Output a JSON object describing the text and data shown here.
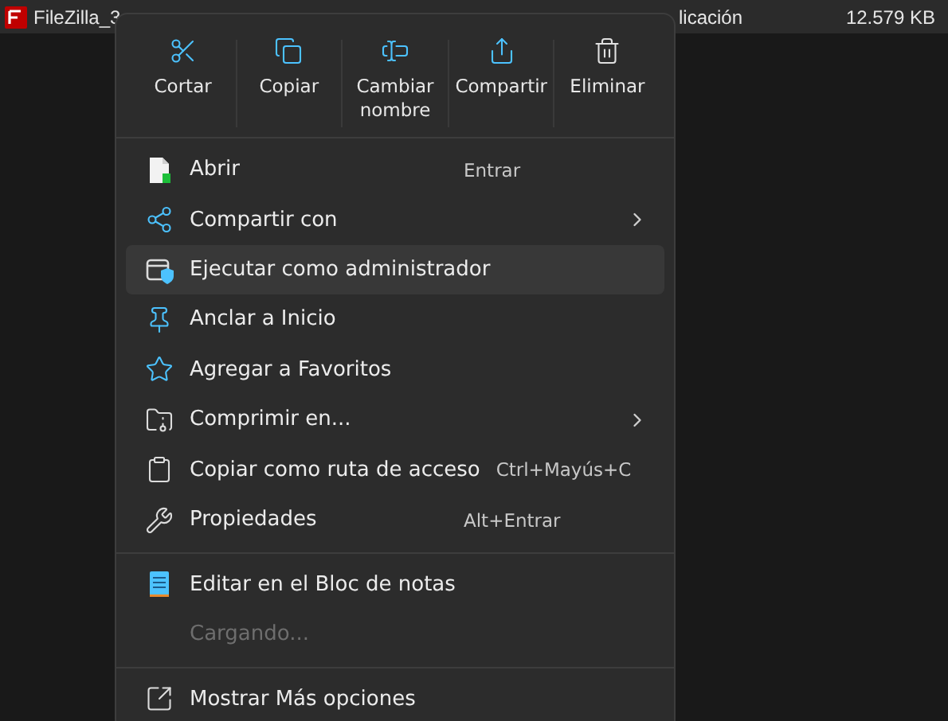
{
  "file_row": {
    "name": "FileZilla_3",
    "type": "licación",
    "size": "12.579 KB"
  },
  "context_menu": {
    "toolbar": [
      {
        "label": "Cortar"
      },
      {
        "label": "Copiar"
      },
      {
        "label": "Cambiar nombre"
      },
      {
        "label": "Compartir"
      },
      {
        "label": "Eliminar"
      }
    ],
    "items": [
      {
        "kind": "item",
        "label": "Abrir",
        "shortcut": "Entrar",
        "submenu": false,
        "selected": false,
        "disabled": false
      },
      {
        "kind": "item",
        "label": "Compartir con",
        "submenu": true,
        "selected": false,
        "disabled": false
      },
      {
        "kind": "item",
        "label": "Ejecutar como administrador",
        "submenu": false,
        "selected": true,
        "disabled": false
      },
      {
        "kind": "item",
        "label": "Anclar a Inicio",
        "submenu": false,
        "selected": false,
        "disabled": false
      },
      {
        "kind": "item",
        "label": "Agregar a Favoritos",
        "submenu": false,
        "selected": false,
        "disabled": false
      },
      {
        "kind": "item",
        "label": "Comprimir en...",
        "submenu": true,
        "selected": false,
        "disabled": false
      },
      {
        "kind": "item",
        "label": "Copiar como ruta de acceso",
        "shortcut": "Ctrl+Mayús+C",
        "submenu": false,
        "selected": false,
        "disabled": false
      },
      {
        "kind": "item",
        "label": "Propiedades",
        "shortcut": "Alt+Entrar",
        "submenu": false,
        "selected": false,
        "disabled": false
      },
      {
        "kind": "separator"
      },
      {
        "kind": "item",
        "label": "Editar en el Bloc de notas",
        "submenu": false,
        "selected": false,
        "disabled": false
      },
      {
        "kind": "item",
        "label": "Cargando...",
        "submenu": false,
        "selected": false,
        "disabled": true
      },
      {
        "kind": "separator"
      },
      {
        "kind": "item",
        "label": "Mostrar Más opciones",
        "submenu": false,
        "selected": false,
        "disabled": false
      }
    ]
  }
}
